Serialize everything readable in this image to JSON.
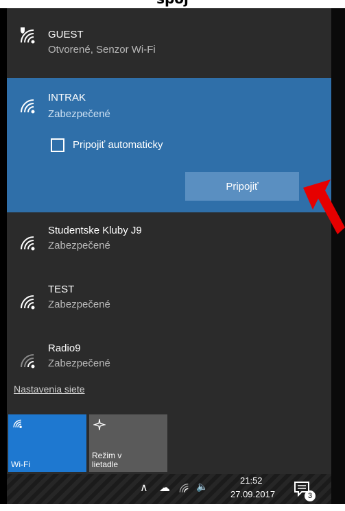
{
  "caption": "spoj",
  "networks": [
    {
      "name": "GUEST",
      "status": "Otvorené, Senzor Wi-Fi"
    },
    {
      "name": "INTRAK",
      "status": "Zabezpečené",
      "auto_connect_label": "Pripojiť automaticky",
      "auto_connect_checked": false,
      "connect_label": "Pripojiť"
    },
    {
      "name": "Studentske Kluby J9",
      "status": "Zabezpečené"
    },
    {
      "name": "TEST",
      "status": "Zabezpečené"
    },
    {
      "name": "Radio9",
      "status": "Zabezpečené"
    }
  ],
  "settings_link": "Nastavenia siete",
  "quick_actions": [
    {
      "label": "Wi-Fi",
      "active": true,
      "icon": "wifi-icon"
    },
    {
      "label_line1": "Režim v",
      "label_line2": "lietadle",
      "active": false,
      "icon": "airplane-icon"
    }
  ],
  "taskbar": {
    "time": "21:52",
    "date": "27.09.2017",
    "notification_count": "3"
  },
  "colors": {
    "flyout_bg": "#2b2b2b",
    "selected_bg": "#2f6fa9",
    "button_bg": "#5a8fc1",
    "wifi_tile": "#1e78d0",
    "annotation_arrow": "#e60000"
  }
}
